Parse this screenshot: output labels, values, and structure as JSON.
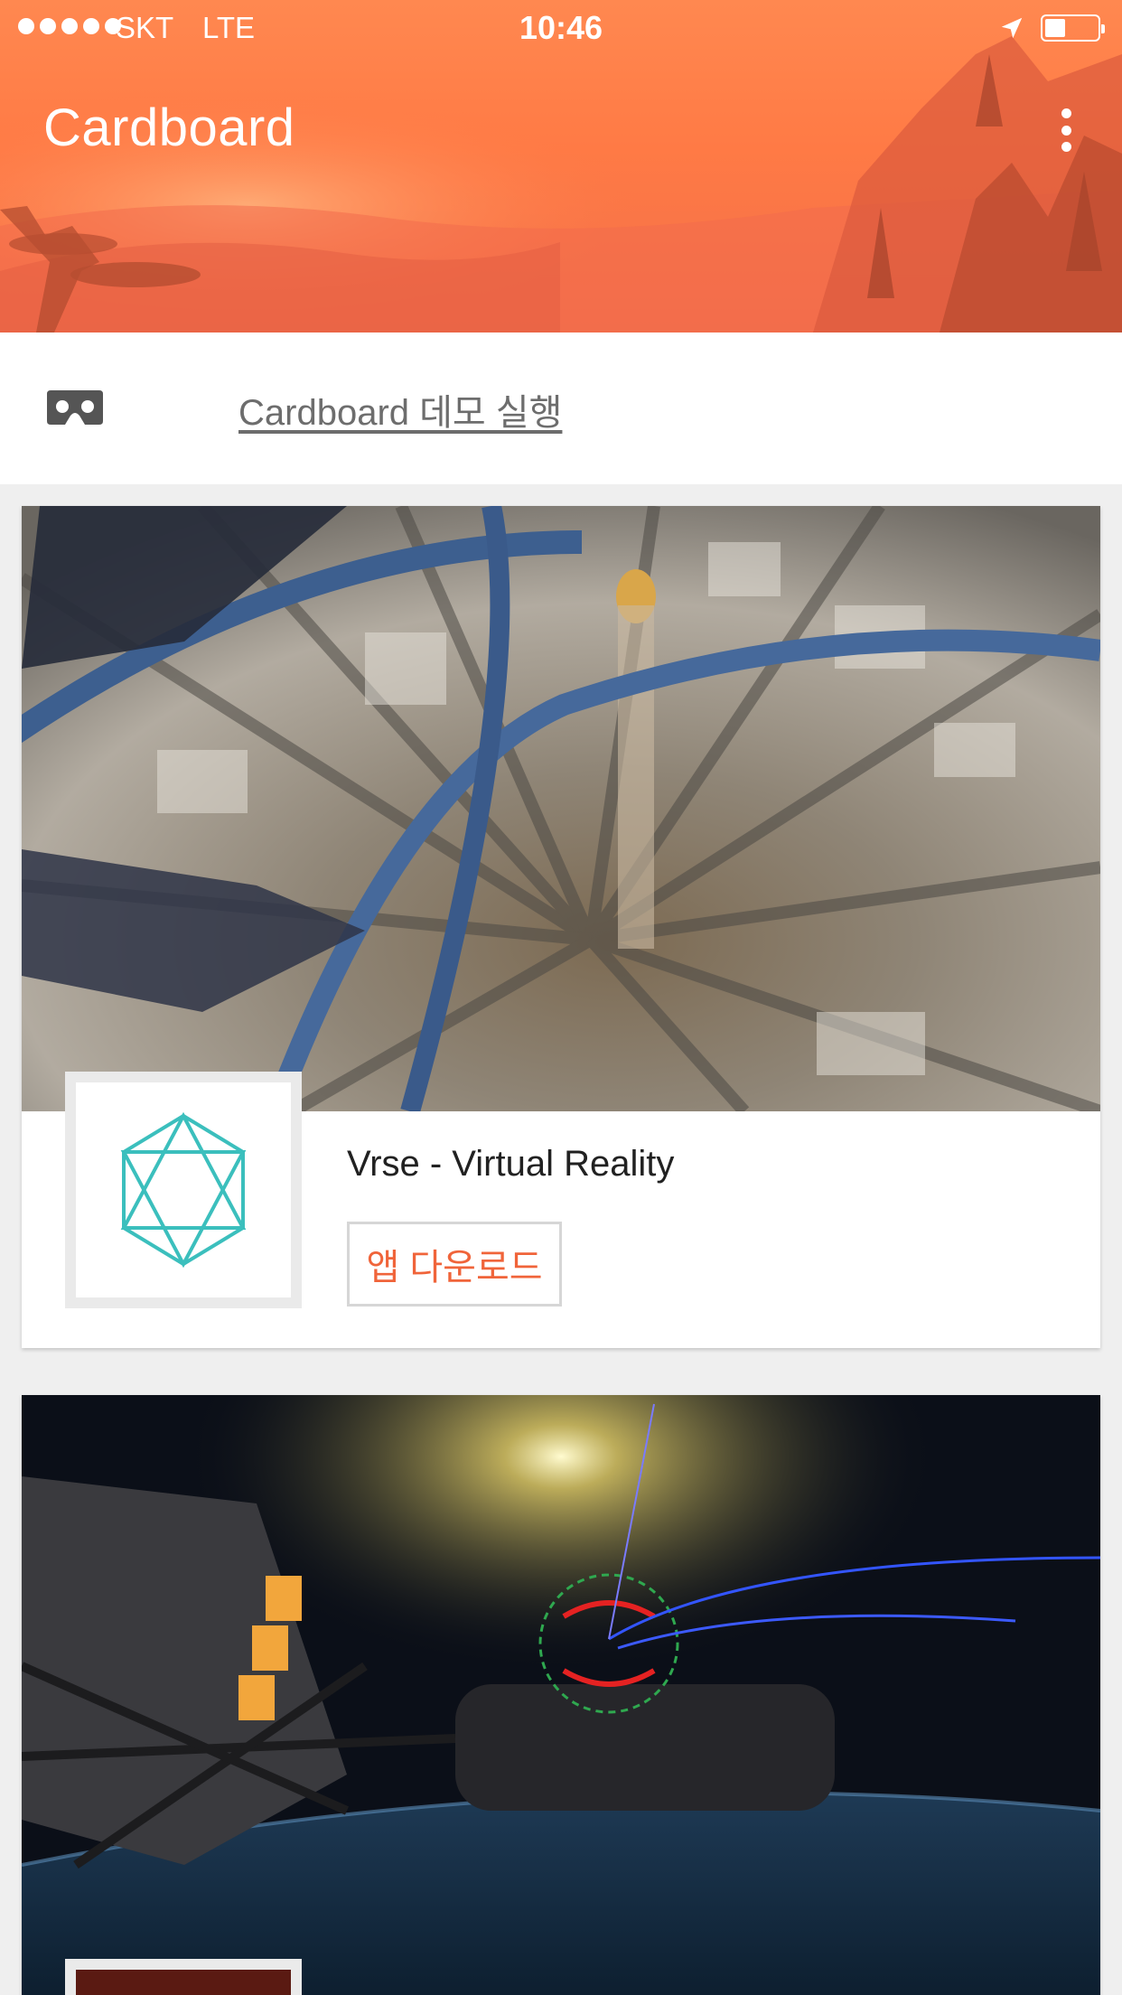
{
  "status_bar": {
    "carrier": "SKT",
    "network": "LTE",
    "time": "10:46",
    "location_icon": "location-arrow-icon",
    "battery_icon": "battery-icon"
  },
  "header": {
    "title": "Cardboard",
    "more_icon": "more-vertical-icon",
    "accent_color": "#ff7a45"
  },
  "demo": {
    "icon": "cardboard-viewer-icon",
    "label": "Cardboard 데모 실행"
  },
  "cards": [
    {
      "app_name": "Vrse - Virtual Reality",
      "button_label": "앱 다운로드",
      "icon": "vrse-hexagon-logo-icon"
    },
    {
      "icon": "app-thumbnail-icon"
    }
  ],
  "colors": {
    "button_text": "#f0643a",
    "vrse_logo": "#3bbfbd"
  }
}
